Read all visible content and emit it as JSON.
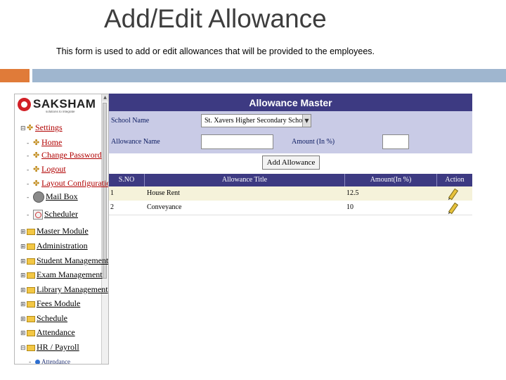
{
  "slide": {
    "title": "Add/Edit Allowance",
    "description": "This form is used to add or edit allowances that will be provided to the employees."
  },
  "app": {
    "logo_text": "SAKSHAM",
    "logo_tagline": "solutions to integrate",
    "scroll_up_icon": "▲"
  },
  "sidebar": {
    "settings": "Settings",
    "items": [
      "Home",
      "Change Password",
      "Logout",
      "Layout Configuration",
      "Mail Box",
      "Scheduler"
    ],
    "modules": [
      "Master Module",
      "Administration",
      "Student Management",
      "Exam Management",
      "Library Management",
      "Fees Module",
      "Schedule",
      "Attendance",
      "HR / Payroll"
    ],
    "sub_item": "Attendance"
  },
  "main": {
    "header": "Allowance Master",
    "school_label": "School Name",
    "school_value": "St. Xavers Higher Secondary School",
    "allowance_label": "Allowance Name",
    "amount_label": "Amount (In %)",
    "add_button": "Add Allowance",
    "table": {
      "columns": [
        "S.NO",
        "Allowance Title",
        "Amount(In %)",
        "Action"
      ],
      "rows": [
        {
          "sno": "1",
          "title": "House Rent",
          "amount": "12.5"
        },
        {
          "sno": "2",
          "title": "Conveyance",
          "amount": "10"
        }
      ]
    }
  },
  "colors": {
    "header_navy": "#3d3a82",
    "form_bg": "#c9cbe6",
    "row_cream": "#f5f2da",
    "accent_orange": "#e07b39",
    "accent_blue": "#9fb6cf"
  }
}
